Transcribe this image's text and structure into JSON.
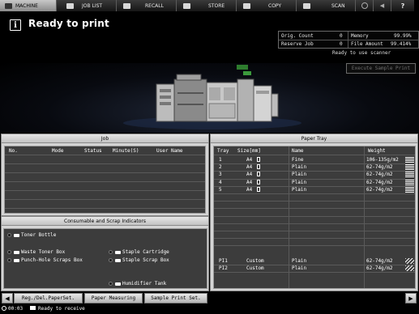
{
  "tabs": [
    {
      "label": "MACHINE",
      "icon": "printer-icon"
    },
    {
      "label": "JOB LIST",
      "icon": "job-list-icon"
    },
    {
      "label": "RECALL",
      "icon": "recall-icon"
    },
    {
      "label": "STORE",
      "icon": "store-icon"
    },
    {
      "label": "COPY",
      "icon": "copy-icon"
    },
    {
      "label": "SCAN",
      "icon": "scan-icon"
    }
  ],
  "tab_extras": {
    "help": "?"
  },
  "header": {
    "status_title": "Ready to print",
    "info_glyph": "i",
    "counters": [
      {
        "label": "Orig. Count",
        "value": "0",
        "label2": "Memory",
        "value2": "99.99%"
      },
      {
        "label": "Reserve Job",
        "value": "0",
        "label2": "File Amount",
        "value2": "99.414%"
      }
    ],
    "scanner_status": "Ready to use scanner",
    "execute_sample_label": "Execute Sample Print"
  },
  "job_panel": {
    "title": "Job",
    "columns": [
      "No.",
      "Mode",
      "Status",
      "Minute(S)",
      "User Name"
    ]
  },
  "paper_tray": {
    "title": "Paper Tray",
    "columns": [
      "Tray",
      "Size[mm]",
      "Name",
      "Weight"
    ],
    "rows": [
      {
        "tray": "1",
        "size": "A4",
        "name": "Fine",
        "weight": "106-135g/m2"
      },
      {
        "tray": "2",
        "size": "A4",
        "name": "Plain",
        "weight": "62-74g/m2"
      },
      {
        "tray": "3",
        "size": "A4",
        "name": "Plain",
        "weight": "62-74g/m2"
      },
      {
        "tray": "4",
        "size": "A4",
        "name": "Plain",
        "weight": "62-74g/m2"
      },
      {
        "tray": "5",
        "size": "A4",
        "name": "Plain",
        "weight": "62-74g/m2"
      }
    ],
    "pi_rows": [
      {
        "tray": "PI1",
        "size": "Custom",
        "name": "Plain",
        "weight": "62-74g/m2"
      },
      {
        "tray": "PI2",
        "size": "Custom",
        "name": "Plain",
        "weight": "62-74g/m2"
      }
    ]
  },
  "consumables": {
    "title": "Consumable and Scrap Indicators",
    "items": [
      {
        "label": "Toner Bottle"
      },
      {
        "label": "Waste Toner Box"
      },
      {
        "label": "Punch-Hole Scraps Box"
      },
      {
        "label": "Staple Cartridge"
      },
      {
        "label": "Staple Scrap Box"
      },
      {
        "label": "Humidifier Tank"
      }
    ]
  },
  "bottom_buttons": {
    "prev": "◀",
    "reg_paper": "Reg./Del.PaperSet.",
    "paper_measuring": "Paper Measuring",
    "sample_print": "Sample Print Set.",
    "next": "▶"
  },
  "status_bar": {
    "time": "00:03",
    "message": "Ready to receive"
  }
}
